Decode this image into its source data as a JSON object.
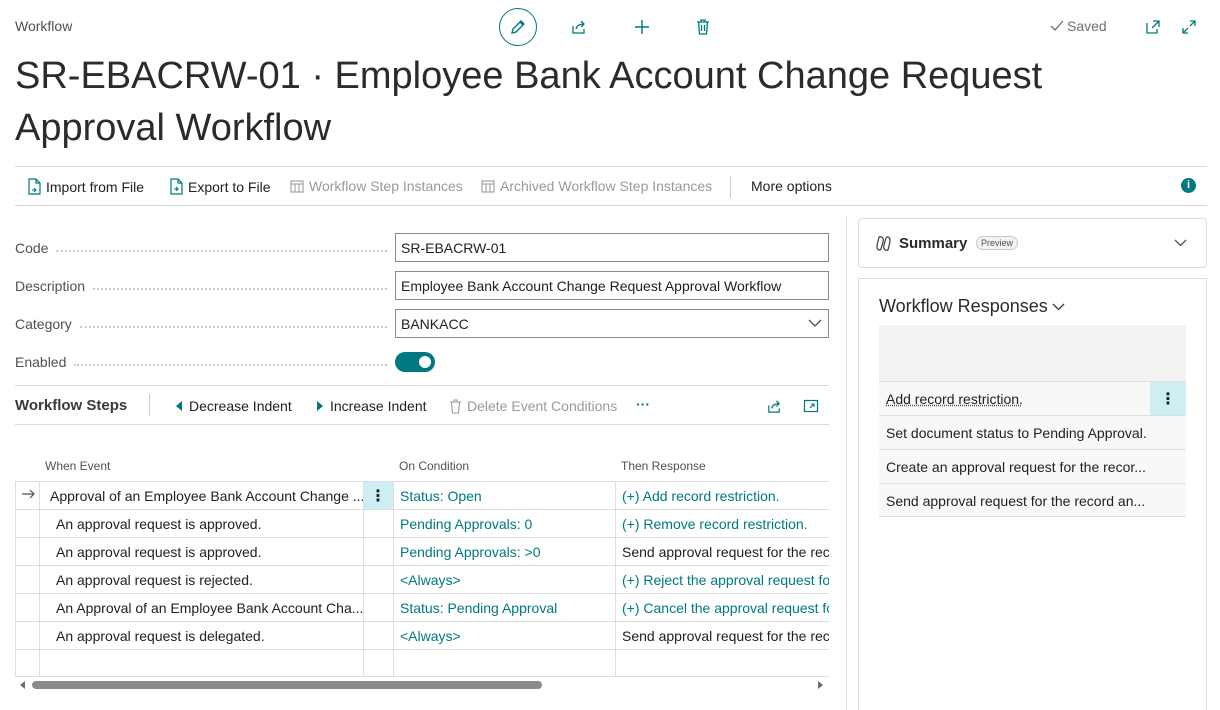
{
  "header": {
    "page_kind": "Workflow",
    "saved_label": "Saved",
    "title": "SR-EBACRW-01 · Employee Bank Account Change Request Approval Workflow"
  },
  "actions": {
    "import": "Import from File",
    "export": "Export to File",
    "step_instances": "Workflow Step Instances",
    "archived_instances": "Archived Workflow Step Instances",
    "more": "More options",
    "info": "i"
  },
  "fields": {
    "code_label": "Code",
    "code_value": "SR-EBACRW-01",
    "description_label": "Description",
    "description_value": "Employee Bank Account Change Request Approval Workflow",
    "category_label": "Category",
    "category_value": "BANKACC",
    "enabled_label": "Enabled",
    "enabled": true
  },
  "steps": {
    "title": "Workflow Steps",
    "decrease_indent": "Decrease Indent",
    "increase_indent": "Increase Indent",
    "delete_conditions": "Delete Event Conditions",
    "more": "···",
    "columns": {
      "event": "When Event",
      "condition": "On Condition",
      "response": "Then Response"
    },
    "rows": [
      {
        "event": "Approval of an Employee Bank Account Change ...",
        "condition": "Status: Open",
        "response": "(+) Add record restriction."
      },
      {
        "event": "An approval request is approved.",
        "condition": "Pending Approvals: 0",
        "response": "(+) Remove record restriction."
      },
      {
        "event": "An approval request is approved.",
        "condition": "Pending Approvals: >0",
        "response": "Send approval request for the rec"
      },
      {
        "event": "An approval request is rejected.",
        "condition": "<Always>",
        "response": "(+) Reject the approval request fo"
      },
      {
        "event": "An Approval of an Employee Bank Account Cha...",
        "condition": "Status: Pending Approval",
        "response": "(+) Cancel the approval request fo"
      },
      {
        "event": "An approval request is delegated.",
        "condition": "<Always>",
        "response": "Send approval request for the rec"
      }
    ],
    "row_menu": "⋮"
  },
  "summary": {
    "title": "Summary",
    "badge": "Preview"
  },
  "responses": {
    "title": "Workflow Responses",
    "items": [
      "Add record restriction.",
      "Set document status to Pending Approval.",
      "Create an approval request for the recor...",
      "Send approval request for the record an..."
    ],
    "row_menu": "⋮"
  },
  "colors": {
    "accent": "#00787f",
    "selection": "#cdeef2"
  }
}
